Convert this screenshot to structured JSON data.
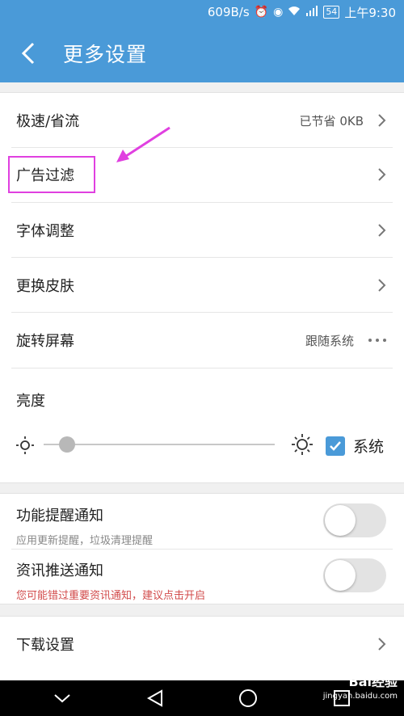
{
  "status_bar": {
    "speed": "609B/s",
    "battery": "54",
    "time": "上午9:30"
  },
  "app_bar": {
    "title": "更多设置"
  },
  "settings": {
    "speed_mode": {
      "label": "极速/省流",
      "value": "已节省 0KB"
    },
    "ad_filter": {
      "label": "广告过滤"
    },
    "font_adjust": {
      "label": "字体调整"
    },
    "skin": {
      "label": "更换皮肤"
    },
    "rotate": {
      "label": "旋转屏幕",
      "value": "跟随系统"
    },
    "brightness": {
      "label": "亮度",
      "level": 0.1,
      "follow_system_label": "系统",
      "follow_system": true
    }
  },
  "notifications": {
    "feature": {
      "label": "功能提醒通知",
      "sub": "应用更新提醒，垃圾清理提醒",
      "enabled": false
    },
    "news": {
      "label": "资讯推送通知",
      "sub": "您可能错过重要资讯通知，建议点击开启",
      "enabled": false
    }
  },
  "download": {
    "label": "下载设置"
  },
  "watermark": {
    "brand": "Bai经验",
    "url": "jingyan.baidu.com"
  },
  "colors": {
    "accent": "#4a9ad8",
    "highlight": "#e040e0",
    "warning": "#d24b4b"
  }
}
